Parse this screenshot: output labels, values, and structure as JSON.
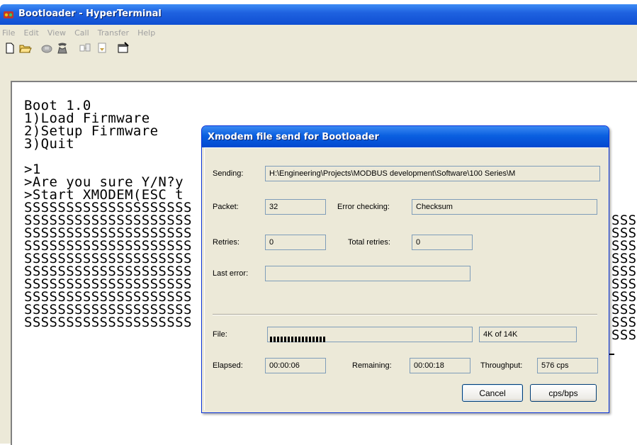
{
  "window": {
    "title": "Bootloader - HyperTerminal"
  },
  "menu": [
    "File",
    "Edit",
    "View",
    "Call",
    "Transfer",
    "Help"
  ],
  "toolbar": {
    "icons": [
      "new-icon",
      "open-icon",
      "disconnect-icon",
      "dial-icon",
      "send-icon",
      "receive-icon",
      "properties-icon"
    ]
  },
  "terminal": {
    "lines": [
      "Boot 1.0",
      "1)Load Firmware",
      "2)Setup Firmware",
      "3)Quit",
      "",
      ">1",
      ">Are you sure Y/N?y",
      ">Start XMODEM(ESC t",
      "SSSSSSSSSSSSSSSSSSSS",
      "SSSSSSSSSSSSSSSSSSSS",
      "SSSSSSSSSSSSSSSSSSSS",
      "SSSSSSSSSSSSSSSSSSSS",
      "SSSSSSSSSSSSSSSSSSSS",
      "SSSSSSSSSSSSSSSSSSSS",
      "SSSSSSSSSSSSSSSSSSSS",
      "SSSSSSSSSSSSSSSSSSSS",
      "SSSSSSSSSSSSSSSSSSSS",
      "SSSSSSSSSSSSSSSSSSSS"
    ],
    "right_fragments": [
      "SSS",
      "SSS",
      "SSS",
      "SSS",
      "SSS",
      "SSS",
      "SSS",
      "SSS",
      "SSS",
      "SSS"
    ]
  },
  "dialog": {
    "title": "Xmodem file send for Bootloader",
    "sending_label": "Sending:",
    "sending_value": "H:\\Engineering\\Projects\\MODBUS development\\Software\\100 Series\\M",
    "packet_label": "Packet:",
    "packet_value": "32",
    "error_checking_label": "Error checking:",
    "error_checking_value": "Checksum",
    "retries_label": "Retries:",
    "retries_value": "0",
    "total_retries_label": "Total retries:",
    "total_retries_value": "0",
    "last_error_label": "Last error:",
    "last_error_value": "",
    "file_label": "File:",
    "file_progress": 0.29,
    "file_size": "4K of 14K",
    "elapsed_label": "Elapsed:",
    "elapsed_value": "00:00:06",
    "remaining_label": "Remaining:",
    "remaining_value": "00:00:18",
    "throughput_label": "Throughput:",
    "throughput_value": "576 cps",
    "cancel_label": "Cancel",
    "cps_label": "cps/bps"
  }
}
